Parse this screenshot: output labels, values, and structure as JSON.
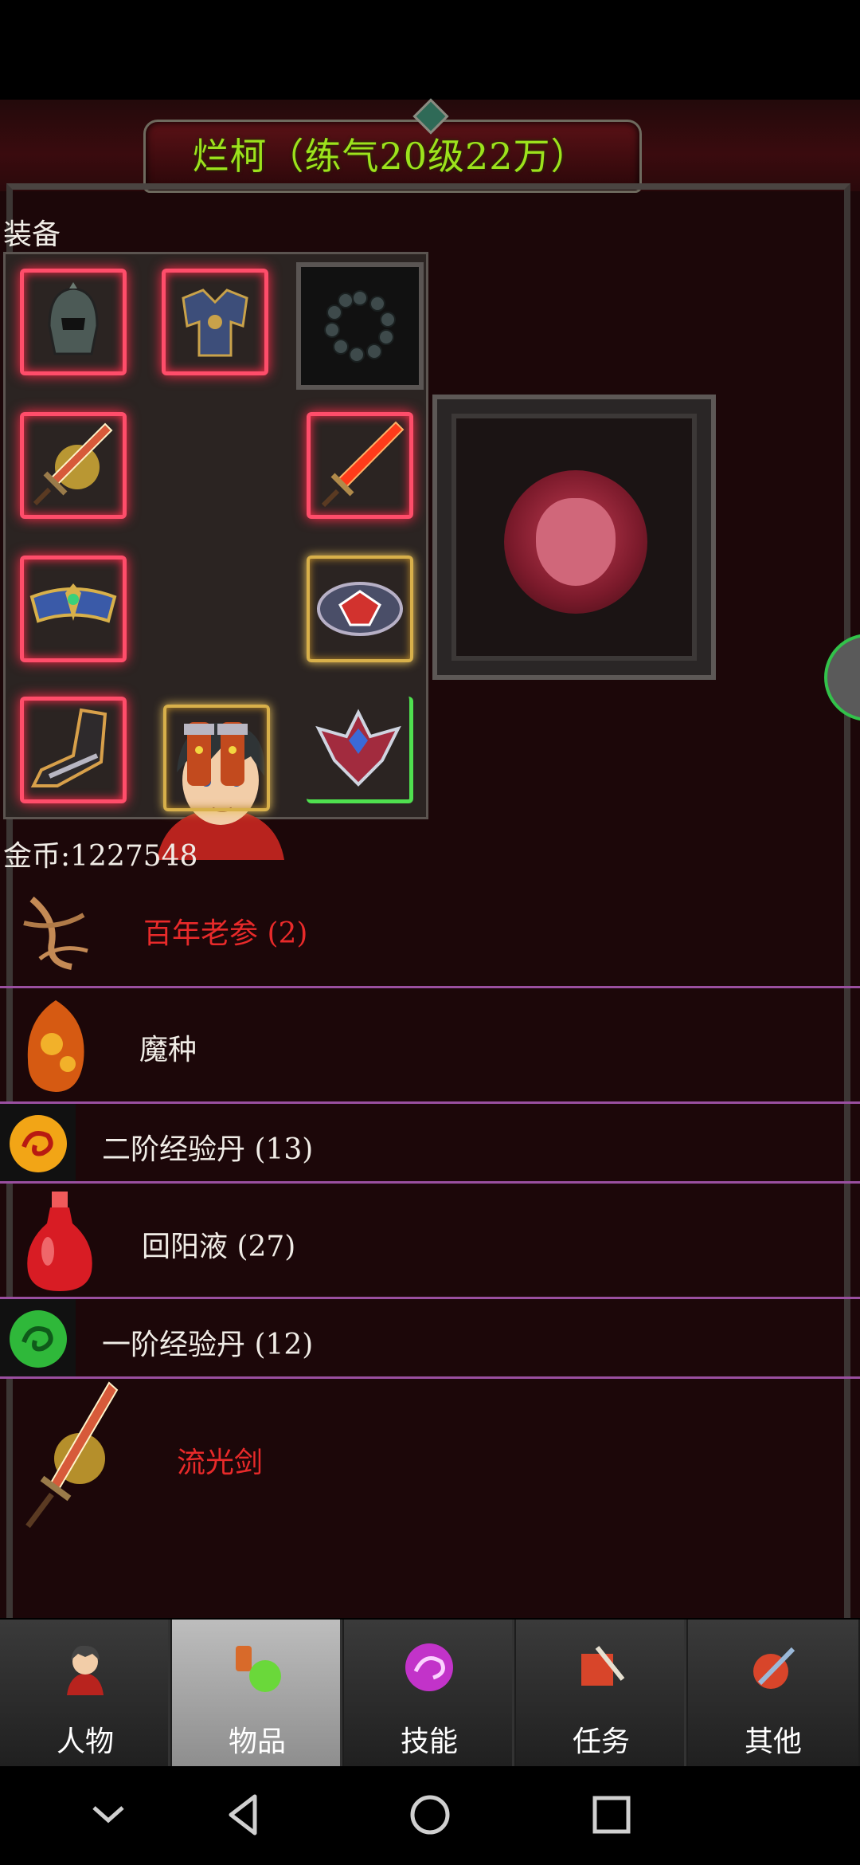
{
  "header": {
    "title": "烂柯（练气20级22万）"
  },
  "equipment": {
    "label": "装备",
    "slots": [
      {
        "name": "helmet",
        "style": "red"
      },
      {
        "name": "armor",
        "style": "red"
      },
      {
        "name": "bead-necklace",
        "style": "plain"
      },
      {
        "name": "sword-left",
        "style": "red"
      },
      {
        "name": "sword-right",
        "style": "red"
      },
      {
        "name": "belt",
        "style": "red"
      },
      {
        "name": "bracer",
        "style": "gold"
      },
      {
        "name": "boots-left",
        "style": "red"
      },
      {
        "name": "greaves",
        "style": "gold"
      },
      {
        "name": "emblem",
        "style": "green"
      }
    ]
  },
  "pet": {
    "name": "tiger-medal"
  },
  "gold": {
    "label": "金币:1227548"
  },
  "inventory": [
    {
      "name": "百年老参 (2)",
      "color": "#e82a2a",
      "icon": "ginseng-icon"
    },
    {
      "name": "魔种",
      "color": "#f0ece6",
      "icon": "demon-seed-icon"
    },
    {
      "name": "二阶经验丹 (13)",
      "color": "#f0ece6",
      "icon": "exp-pill-gold-icon"
    },
    {
      "name": "回阳液 (27)",
      "color": "#f0ece6",
      "icon": "potion-red-icon"
    },
    {
      "name": "一阶经验丹 (12)",
      "color": "#f0ece6",
      "icon": "exp-pill-green-icon"
    },
    {
      "name": "流光剑",
      "color": "#e82a2a",
      "icon": "sword-icon"
    }
  ],
  "tabs": [
    {
      "label": "人物",
      "active": false
    },
    {
      "label": "物品",
      "active": true
    },
    {
      "label": "技能",
      "active": false
    },
    {
      "label": "任务",
      "active": false
    },
    {
      "label": "其他",
      "active": false
    }
  ],
  "colors": {
    "title": "#9de21c",
    "rarity_red": "#e82a2a",
    "divider": "#9a4fa0"
  }
}
